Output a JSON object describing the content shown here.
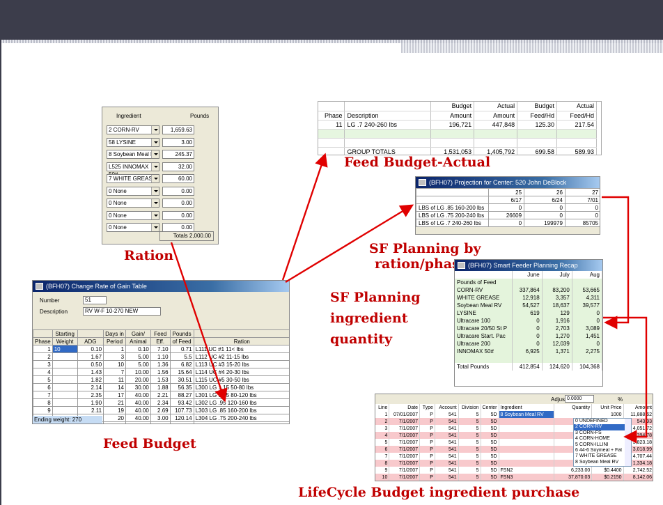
{
  "colors": {
    "banner": "#3c3d4b",
    "caption": "#c00000",
    "arrow": "#e00000"
  },
  "captions": {
    "ration": "Ration",
    "feed_budget": "Feed Budget",
    "feed_budget_actual": "Feed Budget-Actual",
    "sf_planning_ration_1": "SF Planning by",
    "sf_planning_ration_2": "ration/phase",
    "sf_planning_ingredient_1": "SF Planning",
    "sf_planning_ingredient_2": "ingredient",
    "sf_planning_ingredient_3": "quantity",
    "lifecycle": "LifeCycle Budget ingredient purchase"
  },
  "ration": {
    "header_ingredient": "Ingredient",
    "header_pounds": "Pounds",
    "rows": [
      {
        "ingredient": "2 CORN-RV",
        "pounds": "1,659.63"
      },
      {
        "ingredient": "58 LYSINE",
        "pounds": "3.00"
      },
      {
        "ingredient": "8 Soybean Meal RV",
        "pounds": "245.37"
      },
      {
        "ingredient": "L525 INNOMAX 50#",
        "pounds": "32.00"
      },
      {
        "ingredient": "7 WHITE GREASE",
        "pounds": "60.00"
      },
      {
        "ingredient": "0 None",
        "pounds": "0.00"
      },
      {
        "ingredient": "0 None",
        "pounds": "0.00"
      },
      {
        "ingredient": "0 None",
        "pounds": "0.00"
      },
      {
        "ingredient": "0 None",
        "pounds": "0.00"
      }
    ],
    "totals_label": "Totals",
    "totals_value": "2,000.00"
  },
  "feed_budget_actual": {
    "headers_top": [
      "",
      "",
      "Budget",
      "Actual",
      "Budget",
      "Actual"
    ],
    "headers_bottom": [
      "Phase",
      "Description",
      "Amount",
      "Amount",
      "Feed/Hd",
      "Feed/Hd"
    ],
    "row": {
      "phase": "11",
      "description": "LG .7 240-260 lbs",
      "budget_amount": "196,721",
      "actual_amount": "447,848",
      "budget_feed": "125.30",
      "actual_feed": "217.54"
    },
    "totals": {
      "label": "GROUP TOTALS",
      "budget_amount": "1,531,053",
      "actual_amount": "1,405,792",
      "budget_feed": "699.58",
      "actual_feed": "589.93"
    }
  },
  "projection": {
    "title": "(BFH07)  Projection for Center:  520  John DeBlock",
    "weeks": [
      "25",
      "26",
      "27"
    ],
    "dates": [
      "6/17",
      "6/24",
      "7/01"
    ],
    "rows": [
      {
        "label": "LBS of LG .85 160-200 lbs",
        "v": [
          "0",
          "0",
          "0"
        ]
      },
      {
        "label": "LBS of LG .75 200-240 lbs",
        "v": [
          "26609",
          "0",
          "0"
        ]
      },
      {
        "label": "LBS of LG .7 240-260 lbs",
        "v": [
          "0",
          "199979",
          "85705"
        ]
      }
    ]
  },
  "recap": {
    "title": "(BFH07)  Smart Feeder Planning Recap",
    "months": [
      "June",
      "July",
      "Aug"
    ],
    "section": "Pounds of Feed",
    "rows": [
      {
        "label": "CORN-RV",
        "v": [
          "337,864",
          "83,200",
          "53,665"
        ]
      },
      {
        "label": "WHITE GREASE",
        "v": [
          "12,918",
          "3,357",
          "4,311"
        ]
      },
      {
        "label": "Soybean Meal RV",
        "v": [
          "54,527",
          "18,637",
          "39,577"
        ]
      },
      {
        "label": "LYSINE",
        "v": [
          "619",
          "129",
          "0"
        ]
      },
      {
        "label": "Ultracare 100",
        "v": [
          "0",
          "1,916",
          "0"
        ]
      },
      {
        "label": "Ultracare 20/50 St P",
        "v": [
          "0",
          "2,703",
          "3,089"
        ]
      },
      {
        "label": "Ultracare Start. Pac",
        "v": [
          "0",
          "1,270",
          "1,451"
        ]
      },
      {
        "label": "Ultracare 200",
        "v": [
          "0",
          "12,039",
          "0"
        ]
      },
      {
        "label": "INNOMAX 50#",
        "v": [
          "6,925",
          "1,371",
          "2,275"
        ]
      }
    ],
    "total_label": "Total Pounds",
    "total": [
      "412,854",
      "124,620",
      "104,368"
    ]
  },
  "change_gain": {
    "title": "(BFH07)  Change Rate of Gain Table",
    "number_label": "Number",
    "number_value": "51",
    "description_label": "Description",
    "description_value": "RV W-F 10-270 NEW",
    "headers_top": [
      "",
      "Starting",
      "",
      "Days in",
      "Gain/",
      "Feed",
      "Pounds",
      ""
    ],
    "headers_bottom": [
      "Phase",
      "Weight",
      "ADG",
      "Period",
      "Animal",
      "Eff.",
      "of Feed",
      "Ration"
    ],
    "rows": [
      [
        "1",
        "10",
        "0.10",
        "1",
        "0.10",
        "7.10",
        "0.71",
        "L111 UC #1 11< lbs"
      ],
      [
        "2",
        "",
        "1.67",
        "3",
        "5.00",
        "1.10",
        "5.5",
        "L112 UC #2 11-15 lbs"
      ],
      [
        "3",
        "",
        "0.50",
        "10",
        "5.00",
        "1.36",
        "6.82",
        "L113 UC #3 15-20 lbs"
      ],
      [
        "4",
        "",
        "1.43",
        "7",
        "10.00",
        "1.56",
        "15.64",
        "L114 UC #4 20-30 lbs"
      ],
      [
        "5",
        "",
        "1.82",
        "11",
        "20.00",
        "1.53",
        "30.51",
        "L115 UC #5 30-50 lbs"
      ],
      [
        "6",
        "",
        "2.14",
        "14",
        "30.00",
        "1.88",
        "56.35",
        "L300 LG 1.15 50-80 lbs"
      ],
      [
        "7",
        "",
        "2.35",
        "17",
        "40.00",
        "2.21",
        "88.27",
        "L301 LG 1.05 80-120 lbs"
      ],
      [
        "8",
        "",
        "1.90",
        "21",
        "40.00",
        "2.34",
        "93.42",
        "L302 LG .95 120-160 lbs"
      ],
      [
        "9",
        "",
        "2.11",
        "19",
        "40.00",
        "2.69",
        "107.73",
        "L303 LG .85 160-200 lbs"
      ],
      [
        "10",
        "",
        "2.00",
        "20",
        "40.00",
        "3.00",
        "120.14",
        "L304 LG .75 200-240 lbs"
      ],
      [
        "11",
        "",
        "1.43",
        "21",
        "30.00",
        "3.39",
        "101.65",
        "L305 LG .7 240-260 lbs"
      ],
      [
        "12",
        "",
        "",
        "",
        "",
        "",
        "",
        ""
      ]
    ],
    "ending_weight": "Ending weight:  270"
  },
  "lifecycle": {
    "adjust_label": "Adjust",
    "adjust_value": "0.0000",
    "adjust_unit": "%",
    "headers": [
      "Line",
      "Date",
      "Type",
      "Account",
      "Division",
      "Center",
      "Ingredient",
      "Quantity",
      "Unit Price",
      "Amount"
    ],
    "rows": [
      [
        "1",
        "07/01/2007",
        "P",
        "541",
        "5",
        "5D",
        "8  Soybean Meal RV",
        "",
        "1000",
        "11,888.62"
      ],
      [
        "2",
        "7/1/2007",
        "P",
        "541",
        "5",
        "5D",
        "",
        "",
        "0000",
        "543.93"
      ],
      [
        "3",
        "7/1/2007",
        "P",
        "541",
        "5",
        "5D",
        "",
        "",
        "1050",
        "4,051.72"
      ],
      [
        "4",
        "7/1/2007",
        "P",
        "541",
        "5",
        "5D",
        "",
        "",
        "1000",
        "2,394.78"
      ],
      [
        "5",
        "7/1/2007",
        "P",
        "541",
        "5",
        "5D",
        "",
        "",
        "0980",
        "3,823.18"
      ],
      [
        "6",
        "7/1/2007",
        "P",
        "541",
        "5",
        "5D",
        "",
        "",
        "1420",
        "3,018.99"
      ],
      [
        "7",
        "7/1/2007",
        "P",
        "541",
        "5",
        "5D",
        "",
        "",
        "1170",
        "4,707.44"
      ],
      [
        "8",
        "7/1/2007",
        "P",
        "541",
        "5",
        "5D",
        "",
        "",
        "1280",
        "1,334.18"
      ],
      [
        "9",
        "7/1/2007",
        "P",
        "541",
        "5",
        "5D",
        "FSN2",
        "6,233.00",
        "$0.4400",
        "2,742.52"
      ],
      [
        "10",
        "7/1/2007",
        "P",
        "541",
        "5",
        "5D",
        "FSN3",
        "37,870.03",
        "$0.2150",
        "8,142.06"
      ]
    ],
    "dropdown": [
      "0  UNDEFINED",
      "2  CORN-RV",
      "3  CORN-FS",
      "4  CORN-HOME",
      "5  CORN-ILLINI",
      "6  44-6 Soymeal + Fat",
      "7  WHITE GREASE",
      "8  Soybean Meal RV"
    ],
    "dropdown_selected": 1
  }
}
